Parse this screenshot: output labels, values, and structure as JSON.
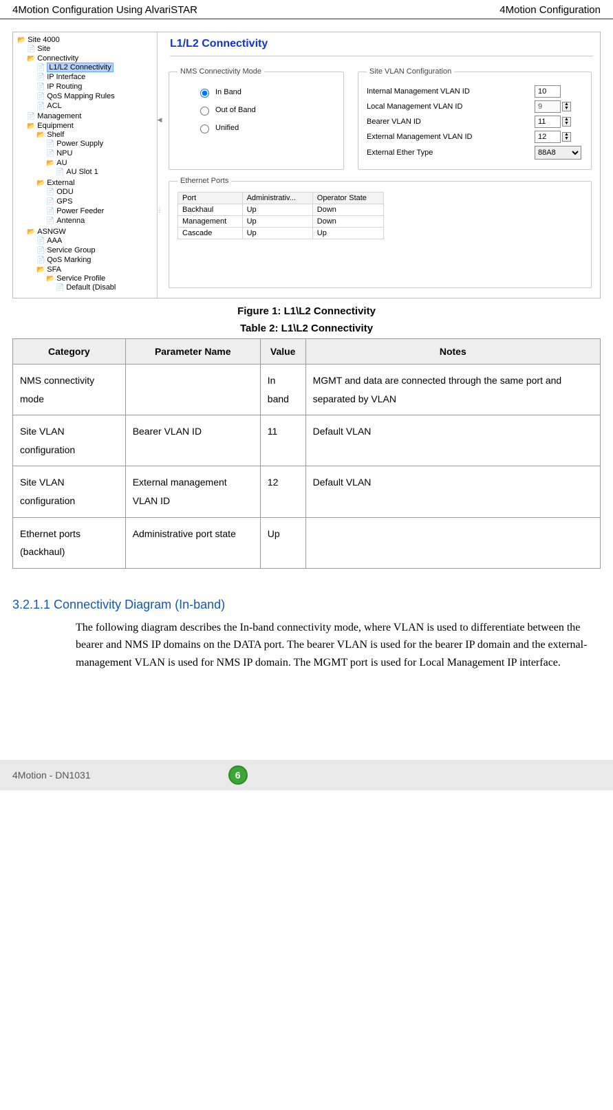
{
  "header": {
    "left": "4Motion Configuration Using AlvariSTAR",
    "right": "4Motion Configuration"
  },
  "tree": {
    "root": "Site 4000",
    "items": {
      "site": "Site",
      "connectivity": "Connectivity",
      "l1l2": "L1/L2 Connectivity",
      "ipif": "IP Interface",
      "iprt": "IP Routing",
      "qos": "QoS Mapping Rules",
      "acl": "ACL",
      "mgmt": "Management",
      "equip": "Equipment",
      "shelf": "Shelf",
      "psu": "Power Supply",
      "npu": "NPU",
      "au": "AU",
      "auslot": "AU Slot 1",
      "external": "External",
      "odu": "ODU",
      "gps": "GPS",
      "pfeeder": "Power Feeder",
      "antenna": "Antenna",
      "asngw": "ASNGW",
      "aaa": "AAA",
      "svcgrp": "Service Group",
      "qosm": "QoS Marking",
      "sfa": "SFA",
      "svcprof": "Service Profile",
      "default_dis": "Default (Disabl"
    }
  },
  "panel": {
    "title": "L1/L2 Connectivity",
    "nms_legend": "NMS Connectivity Mode",
    "radios": {
      "inband": "In Band",
      "outband": "Out of Band",
      "unified": "Unified"
    },
    "vlan_legend": "Site VLAN Configuration",
    "vlan": {
      "int_mgmt_lbl": "Internal Management VLAN ID",
      "int_mgmt_val": "10",
      "loc_mgmt_lbl": "Local Management VLAN ID",
      "loc_mgmt_val": "9",
      "bearer_lbl": "Bearer VLAN ID",
      "bearer_val": "11",
      "ext_mgmt_lbl": "External Management VLAN ID",
      "ext_mgmt_val": "12",
      "ether_lbl": "External Ether Type",
      "ether_val": "88A8"
    },
    "eth_legend": "Ethernet Ports",
    "ports_cols": {
      "c1": "Port",
      "c2": "Administrativ...",
      "c3": "Operator State"
    },
    "ports": [
      {
        "port": "Backhaul",
        "admin": "Up",
        "op": "Down"
      },
      {
        "port": "Management",
        "admin": "Up",
        "op": "Down"
      },
      {
        "port": "Cascade",
        "admin": "Up",
        "op": "Up"
      }
    ]
  },
  "figure_caption": "Figure 1: L1\\L2 Connectivity",
  "table_caption": "Table 2: L1\\L2 Connectivity",
  "doc_table": {
    "head": {
      "c1": "Category",
      "c2": "Parameter Name",
      "c3": "Value",
      "c4": "Notes"
    },
    "rows": [
      {
        "c1": "NMS connectivity mode",
        "c2": "",
        "c3": "In band",
        "c4": "MGMT and data are connected through the same port and separated by VLAN"
      },
      {
        "c1": "Site VLAN configuration",
        "c2": "Bearer VLAN ID",
        "c3": "11",
        "c4": "Default VLAN"
      },
      {
        "c1": "Site VLAN configuration",
        "c2": "External management VLAN ID",
        "c3": "12",
        "c4": "Default VLAN"
      },
      {
        "c1": "Ethernet ports (backhaul)",
        "c2": "Administrative port state",
        "c3": "Up",
        "c4": ""
      }
    ]
  },
  "section": {
    "heading": "3.2.1.1  Connectivity Diagram (In-band)",
    "body": "The following diagram describes the In-band connectivity mode, where VLAN is used to differentiate between the bearer and NMS IP domains on the DATA port. The bearer VLAN is used for the bearer IP domain and the external-management VLAN is used for NMS IP domain. The MGMT port is used for Local Management IP interface."
  },
  "footer": {
    "left": "4Motion - DN1031",
    "page": "6"
  }
}
